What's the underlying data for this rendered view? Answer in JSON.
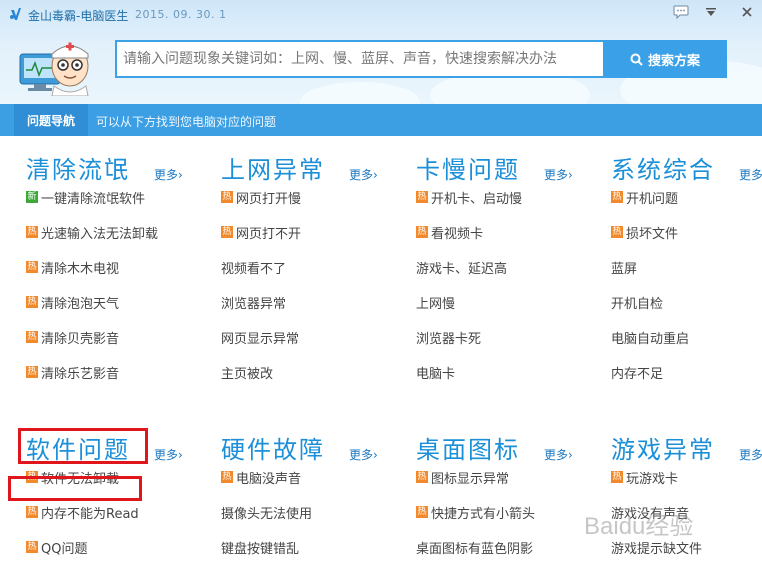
{
  "app": {
    "title": "金山毒霸-电脑医生",
    "version": "2015. 09. 30. 1"
  },
  "search": {
    "placeholder": "请输入问题现象关键词如：上网、慢、蓝屏、声音，快速搜索解决办法",
    "button_label": "搜索方案"
  },
  "nav": {
    "tab_label": "问题导航",
    "hint": "可以从下方找到您电脑对应的问题"
  },
  "more_label": "更多›",
  "sections": [
    {
      "title": "清除流氓",
      "items": [
        {
          "label": "一键清除流氓软件",
          "tag": "新"
        },
        {
          "label": "光速输入法无法卸载",
          "tag": "热"
        },
        {
          "label": "清除木木电视",
          "tag": "热"
        },
        {
          "label": "清除泡泡天气",
          "tag": "热"
        },
        {
          "label": "清除贝壳影音",
          "tag": "热"
        },
        {
          "label": "清除乐艺影音",
          "tag": "热"
        }
      ]
    },
    {
      "title": "上网异常",
      "items": [
        {
          "label": "网页打开慢",
          "tag": "热"
        },
        {
          "label": "网页打不开",
          "tag": "热"
        },
        {
          "label": "视频看不了",
          "tag": ""
        },
        {
          "label": "浏览器异常",
          "tag": ""
        },
        {
          "label": "网页显示异常",
          "tag": ""
        },
        {
          "label": "主页被改",
          "tag": ""
        }
      ]
    },
    {
      "title": "卡慢问题",
      "items": [
        {
          "label": "开机卡、启动慢",
          "tag": "热"
        },
        {
          "label": "看视频卡",
          "tag": "热"
        },
        {
          "label": "游戏卡、延迟高",
          "tag": ""
        },
        {
          "label": "上网慢",
          "tag": ""
        },
        {
          "label": "浏览器卡死",
          "tag": ""
        },
        {
          "label": "电脑卡",
          "tag": ""
        }
      ]
    },
    {
      "title": "系统综合",
      "items": [
        {
          "label": "开机问题",
          "tag": "热"
        },
        {
          "label": "损坏文件",
          "tag": "热"
        },
        {
          "label": "蓝屏",
          "tag": ""
        },
        {
          "label": "开机自检",
          "tag": ""
        },
        {
          "label": "电脑自动重启",
          "tag": ""
        },
        {
          "label": "内存不足",
          "tag": ""
        }
      ]
    },
    {
      "title": "软件问题",
      "items": [
        {
          "label": "软件无法卸载",
          "tag": "热"
        },
        {
          "label": "内存不能为Read",
          "tag": "热"
        },
        {
          "label": "QQ问题",
          "tag": "热"
        }
      ]
    },
    {
      "title": "硬件故障",
      "items": [
        {
          "label": "电脑没声音",
          "tag": "热"
        },
        {
          "label": "摄像头无法使用",
          "tag": ""
        },
        {
          "label": "键盘按键错乱",
          "tag": ""
        }
      ]
    },
    {
      "title": "桌面图标",
      "items": [
        {
          "label": "图标显示异常",
          "tag": "热"
        },
        {
          "label": "快捷方式有小箭头",
          "tag": "热"
        },
        {
          "label": "桌面图标有蓝色阴影",
          "tag": ""
        }
      ]
    },
    {
      "title": "游戏异常",
      "items": [
        {
          "label": "玩游戏卡",
          "tag": "热"
        },
        {
          "label": "游戏没有声音",
          "tag": ""
        },
        {
          "label": "游戏提示缺文件",
          "tag": ""
        }
      ]
    }
  ],
  "watermark": "Baidu经验",
  "colors": {
    "accent": "#3d9fe3",
    "title_blue": "#1b8fd8",
    "hot_tag": "#f28a2b",
    "new_tag": "#3aa937",
    "highlight": "#e0161c"
  }
}
